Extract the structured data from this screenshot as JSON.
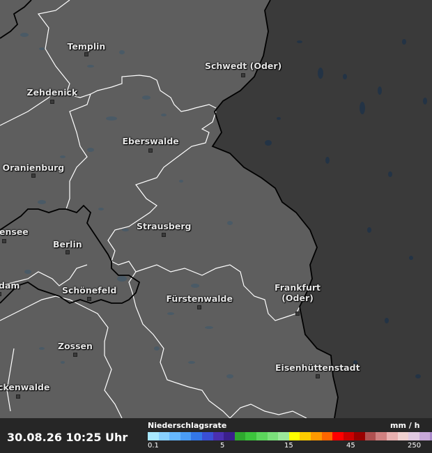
{
  "map": {
    "colors": {
      "germany_land": "#5e5e5e",
      "poland_land": "#3a3a3a",
      "water_de": "#4a5a66",
      "water_pl": "#233345",
      "state_border": "#ffffff",
      "national_border": "#000000"
    },
    "cities": [
      {
        "label": "Templin"
      },
      {
        "label": "Schwedt (Oder)"
      },
      {
        "label": "Zehdenick"
      },
      {
        "label": "Eberswalde"
      },
      {
        "label": "Oranienburg"
      },
      {
        "label": "ensee"
      },
      {
        "label": "Berlin"
      },
      {
        "label": "Strausberg"
      },
      {
        "label": "dam"
      },
      {
        "label": "Schönefeld"
      },
      {
        "label": "Fürstenwalde"
      },
      {
        "label": "Frankfurt\n(Oder)"
      },
      {
        "label": "Zossen"
      },
      {
        "label": "Eisenhüttenstadt"
      },
      {
        "label": "ckenwalde"
      }
    ]
  },
  "footer": {
    "timestamp": "30.08.26 10:25 Uhr",
    "legend_title": "Niederschlagsrate",
    "legend_unit": "mm / h",
    "ticks": [
      "0.1",
      "5",
      "15",
      "45",
      "250"
    ],
    "scale_colors": [
      "#a8e8ff",
      "#88d0ff",
      "#66b8ff",
      "#4a9cf5",
      "#3377e8",
      "#3a4fd6",
      "#4a2fb0",
      "#3b1f8c",
      "#2ea82e",
      "#3cc43c",
      "#5bd65b",
      "#7ae07a",
      "#9be89b",
      "#ffff00",
      "#ffcc00",
      "#ff9900",
      "#ff6600",
      "#ff0000",
      "#cc0000",
      "#990000",
      "#b05050",
      "#d08080",
      "#e8b0b0",
      "#f0d0d0",
      "#e0c8e0",
      "#c8a8d8",
      "#a888c8"
    ]
  }
}
